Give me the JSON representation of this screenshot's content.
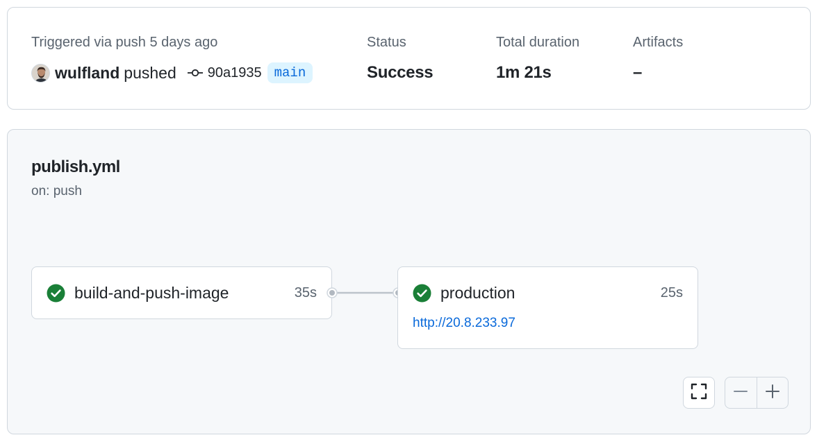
{
  "summary": {
    "trigger_label": "Triggered via push 5 days ago",
    "actor": "wulfland",
    "action": "pushed",
    "commit_sha": "90a1935",
    "branch": "main",
    "status_label": "Status",
    "status_value": "Success",
    "duration_label": "Total duration",
    "duration_value": "1m 21s",
    "artifacts_label": "Artifacts",
    "artifacts_value": "–"
  },
  "workflow": {
    "file": "publish.yml",
    "trigger": "on: push",
    "jobs": [
      {
        "name": "build-and-push-image",
        "duration": "35s",
        "status": "success",
        "status_icon": "check-circle-icon"
      },
      {
        "name": "production",
        "duration": "25s",
        "status": "success",
        "status_icon": "check-circle-icon",
        "environment_url": "http://20.8.233.97"
      }
    ]
  },
  "controls": {
    "fullscreen_icon": "fullscreen-icon",
    "zoom_out_icon": "minus-icon",
    "zoom_in_icon": "plus-icon"
  },
  "colors": {
    "success": "#1a7f37",
    "link": "#0969da",
    "branch_bg": "#ddf4ff",
    "muted_text": "#59636e",
    "border": "#d0d7de",
    "graph_bg": "#f6f8fa"
  }
}
